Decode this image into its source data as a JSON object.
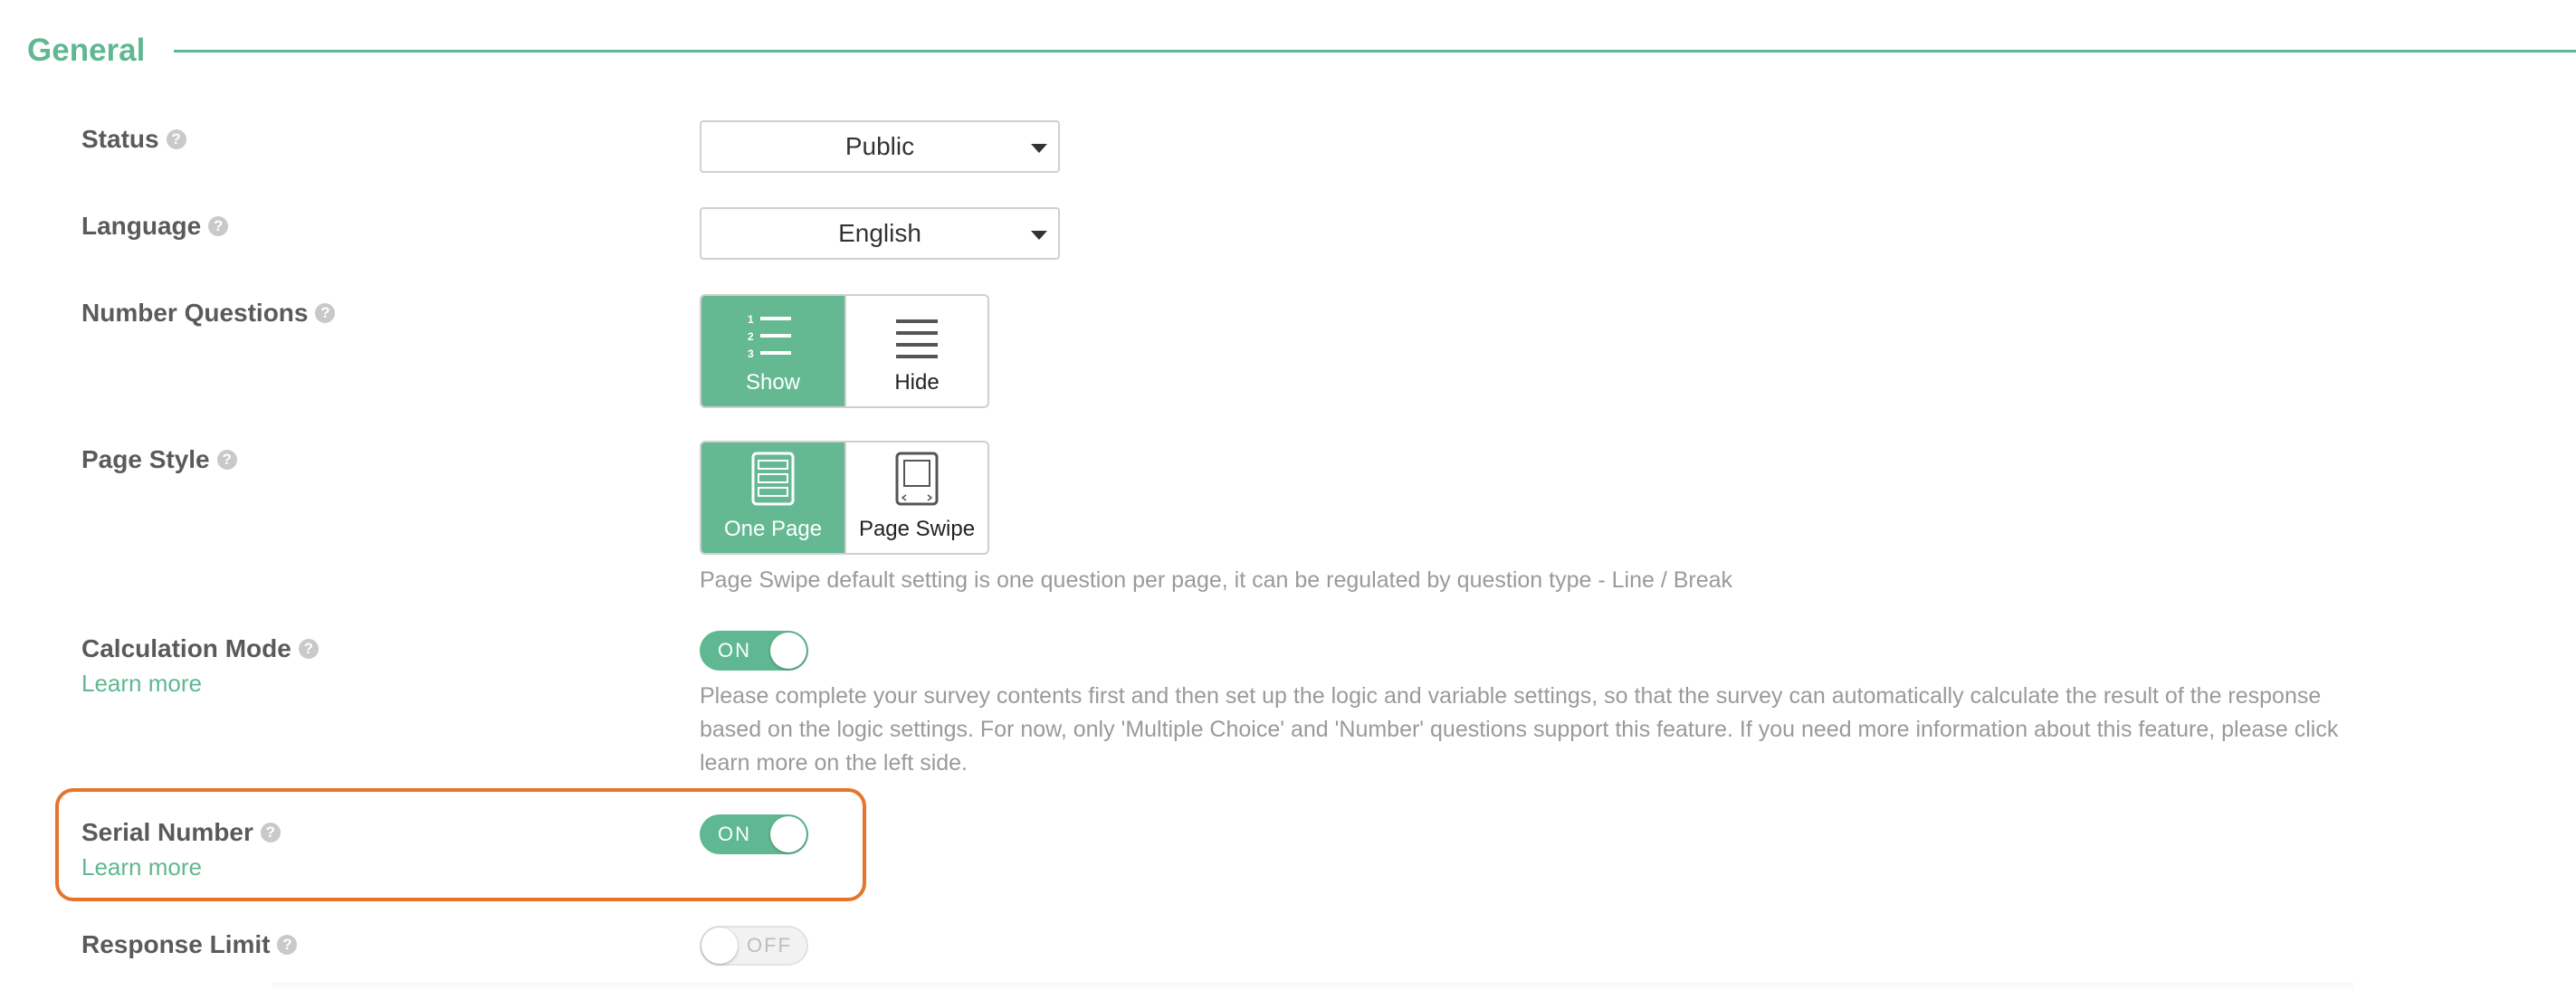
{
  "section": {
    "title": "General"
  },
  "help_glyph": "?",
  "rows": {
    "status": {
      "label": "Status",
      "value": "Public"
    },
    "language": {
      "label": "Language",
      "value": "English"
    },
    "number_questions": {
      "label": "Number Questions",
      "options": [
        "Show",
        "Hide"
      ],
      "selected": "Show"
    },
    "page_style": {
      "label": "Page Style",
      "options": [
        "One Page",
        "Page Swipe"
      ],
      "selected": "One Page",
      "hint": "Page Swipe default setting is one question per page, it can be regulated by question type - Line / Break"
    },
    "calculation_mode": {
      "label": "Calculation Mode",
      "learn_more": "Learn more",
      "toggle": "ON",
      "hint_lines": [
        "Please complete your survey contents first and then set up the logic and variable settings, so that the survey can automatically calculate the result of the response",
        "based on the logic settings. For now, only 'Multiple Choice' and 'Number' questions support this feature. If you need more information about this feature, please click",
        "learn more on the left side."
      ]
    },
    "serial_number": {
      "label": "Serial Number",
      "learn_more": "Learn more",
      "toggle": "ON"
    },
    "response_limit": {
      "label": "Response Limit",
      "toggle": "OFF"
    }
  },
  "colors": {
    "accent": "#5fb891",
    "highlight": "#e8742b"
  },
  "icons": [
    "help-icon",
    "chevron-down-icon",
    "numbered-list-icon",
    "list-icon",
    "one-page-icon",
    "page-swipe-icon"
  ]
}
